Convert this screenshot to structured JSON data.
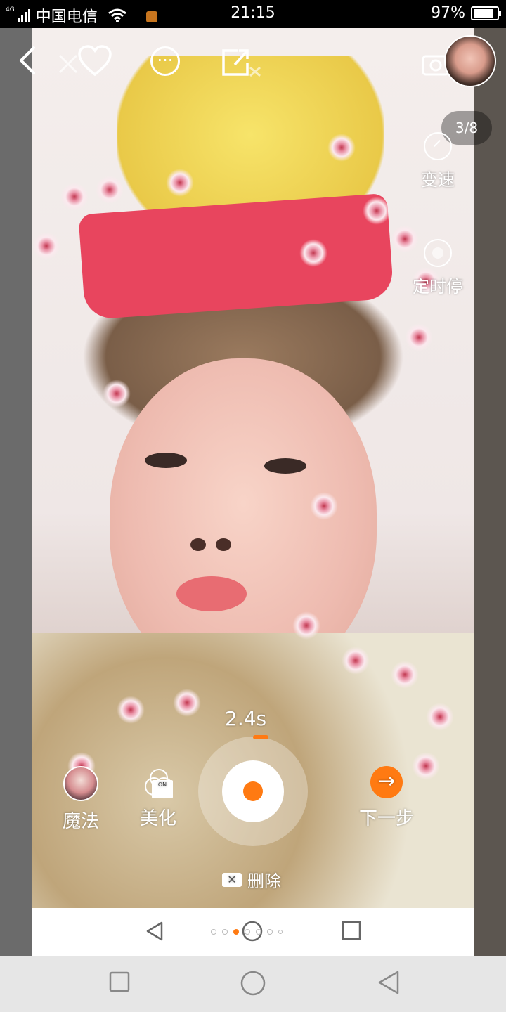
{
  "status_bar": {
    "network": "4G",
    "carrier": "中国电信",
    "time": "21:15",
    "battery_percent": "97%",
    "battery_level": 0.97
  },
  "top_bar": {
    "back_icon": "chevron-left-icon",
    "close_icon": "close-icon",
    "like_icon": "heart-icon",
    "more_icon": "more-icon",
    "share_icon": "share-icon",
    "flip_icon": "flip-camera-icon"
  },
  "page_indicator": "3/8",
  "side_controls": {
    "speed_label": "变速",
    "timer_label": "定时停"
  },
  "recording": {
    "duration": "2.4s",
    "progress_color": "#ff7a12"
  },
  "bottom_controls": {
    "magic_label": "魔法",
    "beauty_label": "美化",
    "beauty_badge": "ON",
    "next_label": "下一步",
    "delete_label": "删除"
  },
  "accent_color": "#ff7a12"
}
